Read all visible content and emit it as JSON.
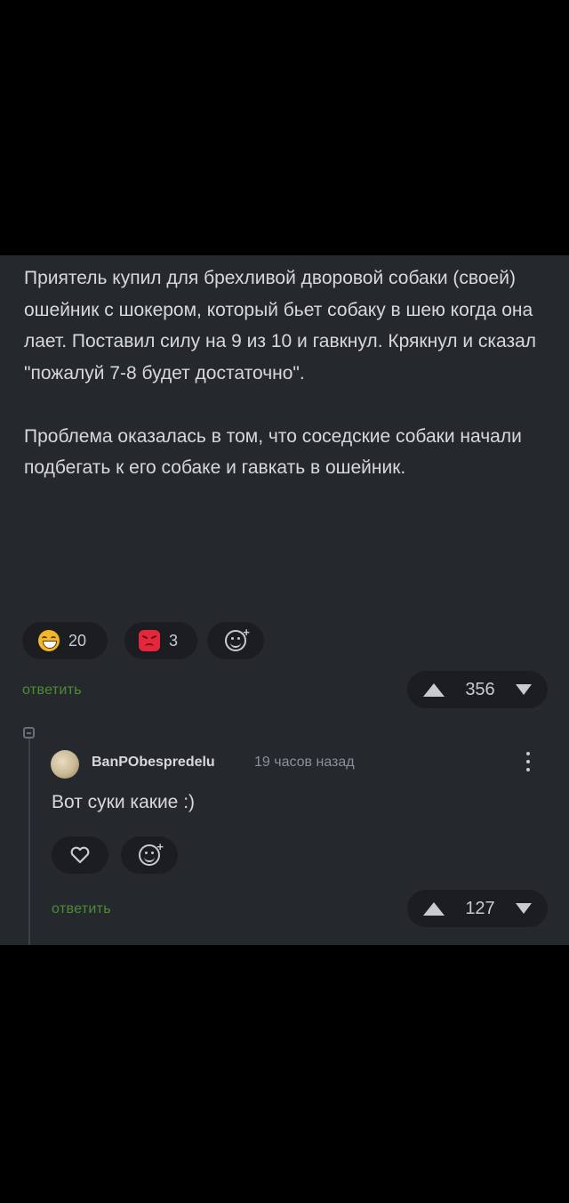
{
  "post": {
    "paragraphs": [
      "Приятель купил для брехливой дворовой собаки (своей) ошейник с шокером, который бьет собаку в шею когда она лает. Поставил силу на 9 из 10 и гавкнул. Крякнул и сказал \"пожалуй 7-8 будет достаточно\".",
      "Проблема оказалась в том, что соседские собаки начали подбегать к его собаке и гавкать в ошейник."
    ],
    "reactions": [
      {
        "icon": "laughing-emoji-icon",
        "count": "20"
      },
      {
        "icon": "angry-emoji-icon",
        "count": "3"
      }
    ],
    "reply_label": "ответить",
    "score": "356"
  },
  "comment": {
    "author": "BanPObespredelu",
    "time": "19 часов назад",
    "text": "Вот суки какие :)",
    "reply_label": "ответить",
    "score": "127"
  },
  "colors": {
    "background": "#000000",
    "panel": "#25282d",
    "chip": "#1b1d21",
    "reply_green": "#4c8e33",
    "text": "#d6d8dc"
  }
}
